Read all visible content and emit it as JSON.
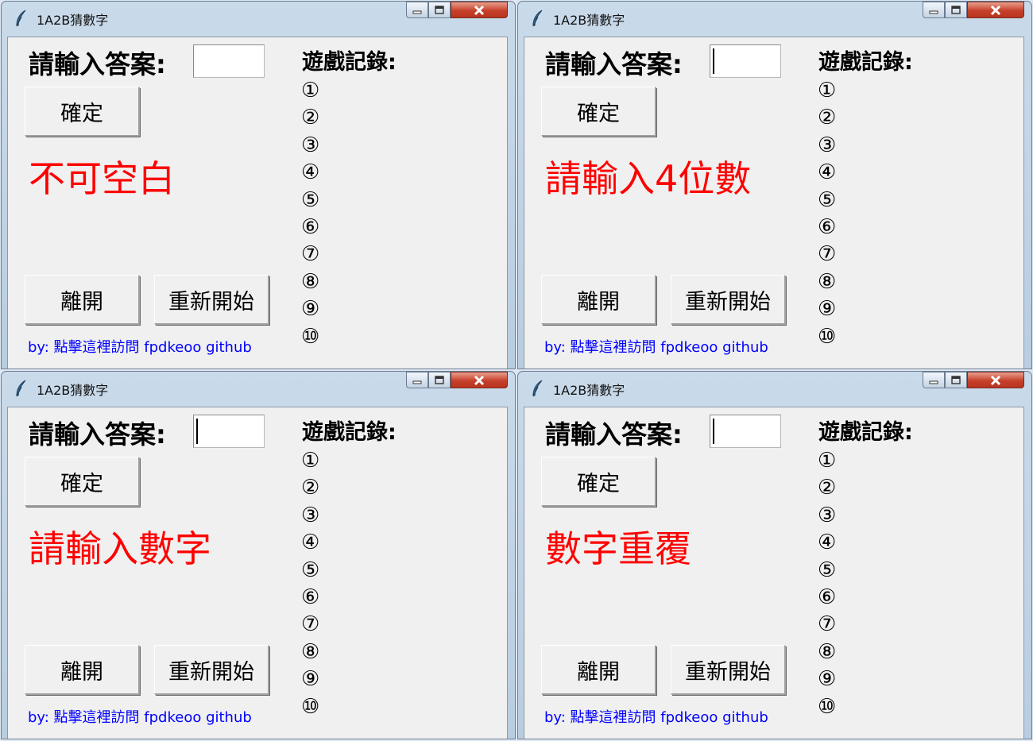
{
  "windows": [
    {
      "title": "1A2B猜數字",
      "prompt_label": "請輸入答案:",
      "answer_value": "",
      "confirm_label": "確定",
      "message": "不可空白",
      "exit_label": "離開",
      "restart_label": "重新開始",
      "credit_text": "by: 點擊這裡訪問 fpdkeoo github",
      "history_title": "遊戲記錄:",
      "history": [
        "①",
        "②",
        "③",
        "④",
        "⑤",
        "⑥",
        "⑦",
        "⑧",
        "⑨",
        "⑩"
      ]
    },
    {
      "title": "1A2B猜數字",
      "prompt_label": "請輸入答案:",
      "answer_value": "",
      "confirm_label": "確定",
      "message": "請輸入4位數",
      "exit_label": "離開",
      "restart_label": "重新開始",
      "credit_text": "by: 點擊這裡訪問 fpdkeoo github",
      "history_title": "遊戲記錄:",
      "history": [
        "①",
        "②",
        "③",
        "④",
        "⑤",
        "⑥",
        "⑦",
        "⑧",
        "⑨",
        "⑩"
      ]
    },
    {
      "title": "1A2B猜數字",
      "prompt_label": "請輸入答案:",
      "answer_value": "",
      "confirm_label": "確定",
      "message": "請輸入數字",
      "exit_label": "離開",
      "restart_label": "重新開始",
      "credit_text": "by: 點擊這裡訪問 fpdkeoo github",
      "history_title": "遊戲記錄:",
      "history": [
        "①",
        "②",
        "③",
        "④",
        "⑤",
        "⑥",
        "⑦",
        "⑧",
        "⑨",
        "⑩"
      ]
    },
    {
      "title": "1A2B猜數字",
      "prompt_label": "請輸入答案:",
      "answer_value": "",
      "confirm_label": "確定",
      "message": "數字重覆",
      "exit_label": "離開",
      "restart_label": "重新開始",
      "credit_text": "by: 點擊這裡訪問 fpdkeoo github",
      "history_title": "遊戲記錄:",
      "history": [
        "①",
        "②",
        "③",
        "④",
        "⑤",
        "⑥",
        "⑦",
        "⑧",
        "⑨",
        "⑩"
      ]
    }
  ],
  "colors": {
    "message": "#ff0000",
    "credit_link": "#0000ff",
    "close_button": "#c6402a"
  },
  "icons": {
    "app": "feather-icon",
    "minimize": "minimize-icon",
    "maximize": "maximize-icon",
    "close": "close-icon"
  }
}
